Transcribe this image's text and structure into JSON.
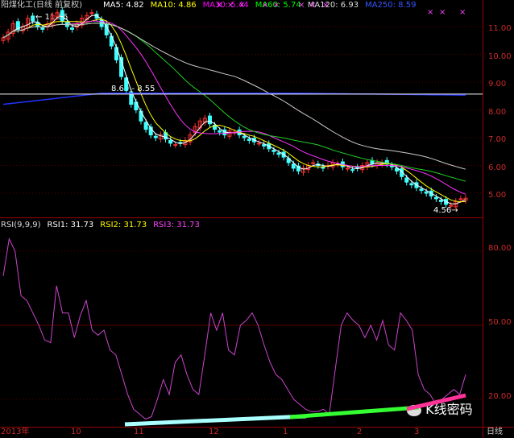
{
  "header": {
    "title": "阳煤化工(日线 前复权)",
    "ma_items": [
      {
        "label": "MA5: 4.82",
        "color": "#ffffff"
      },
      {
        "label": "MA10: 4.86",
        "color": "#ffff00"
      },
      {
        "label": "MA30: 5.44",
        "color": "#ff00ff"
      },
      {
        "label": "MA60: 5.74",
        "color": "#00ff00"
      },
      {
        "label": "MA120: 6.93",
        "color": "#dddddd"
      },
      {
        "label": "MA250: 8.59",
        "color": "#3355ff"
      }
    ]
  },
  "price_panel": {
    "high_marker": "11.56",
    "low_marker": "4.56",
    "ma250_label": "8.60 - 8.55",
    "price_axis": [
      "11.00",
      "10.00",
      "9.00",
      "8.00",
      "7.00",
      "6.00",
      "5.00"
    ]
  },
  "rsi_panel": {
    "header": [
      {
        "label": "RSI(9,9,9)",
        "color": "#dddddd"
      },
      {
        "label": "RSI1: 31.73",
        "color": "#ffffff"
      },
      {
        "label": "RSI2: 31.73",
        "color": "#ffff00"
      },
      {
        "label": "RSI3: 31.73",
        "color": "#ff44ff"
      }
    ],
    "axis": [
      "80.00",
      "50.00",
      "20.00"
    ]
  },
  "time_axis": {
    "year_label": "2013年",
    "months": [
      "10",
      "11",
      "12",
      "1",
      "2",
      "3"
    ],
    "right_label": "日线"
  },
  "watermark": "K线密码",
  "colors": {
    "up_candle": "#ff3030",
    "down_candle": "#40ffff",
    "ma5": "#ffffff",
    "ma10": "#ffff00",
    "ma30": "#ff33ff",
    "ma60": "#22cc22",
    "ma120": "#cccccc",
    "ma250": "#2233ff",
    "rsi": "#cc44cc"
  },
  "chart_data": {
    "type": "line",
    "title": "阳煤化工(日线 前复权)",
    "price_ylim": [
      4.5,
      11.6
    ],
    "months": [
      "10",
      "11",
      "12",
      "1",
      "2",
      "3"
    ],
    "close_series": [
      10.6,
      10.8,
      11.1,
      10.9,
      11.0,
      11.3,
      11.2,
      11.0,
      10.9,
      11.1,
      11.4,
      11.5,
      11.2,
      11.0,
      10.9,
      11.1,
      11.3,
      11.4,
      11.5,
      11.3,
      11.0,
      10.7,
      10.3,
      9.8,
      9.2,
      8.7,
      8.2,
      8.0,
      7.6,
      7.3,
      7.1,
      7.0,
      7.1,
      6.95,
      6.8,
      6.75,
      6.8,
      6.9,
      7.1,
      7.4,
      7.6,
      7.7,
      7.5,
      7.3,
      7.2,
      7.1,
      7.25,
      7.2,
      7.1,
      7.0,
      6.9,
      6.85,
      6.8,
      6.7,
      6.6,
      6.5,
      6.4,
      6.3,
      6.1,
      5.9,
      5.8,
      5.9,
      6.0,
      6.1,
      6.0,
      5.9,
      6.0,
      6.1,
      6.05,
      5.95,
      5.9,
      5.85,
      5.9,
      6.0,
      6.1,
      6.05,
      6.1,
      6.1,
      6.05,
      5.95,
      5.8,
      5.6,
      5.4,
      5.3,
      5.2,
      5.1,
      5.0,
      4.9,
      4.8,
      4.7,
      4.6,
      4.56,
      4.7,
      4.8,
      4.82
    ],
    "rsi_ylim": [
      10,
      92
    ],
    "rsi_series": [
      70,
      85,
      80,
      62,
      60,
      55,
      50,
      44,
      43,
      66,
      55,
      55,
      45,
      54,
      60,
      48,
      46,
      48,
      40,
      38,
      30,
      22,
      16,
      14,
      12,
      13,
      20,
      28,
      22,
      35,
      38,
      30,
      24,
      22,
      38,
      55,
      48,
      55,
      40,
      38,
      50,
      52,
      55,
      50,
      42,
      35,
      30,
      28,
      24,
      20,
      18,
      16,
      15,
      15,
      16,
      14,
      32,
      50,
      55,
      52,
      50,
      45,
      50,
      44,
      52,
      42,
      40,
      55,
      52,
      48,
      30,
      24,
      22,
      18,
      20,
      22,
      24,
      22,
      30
    ]
  }
}
